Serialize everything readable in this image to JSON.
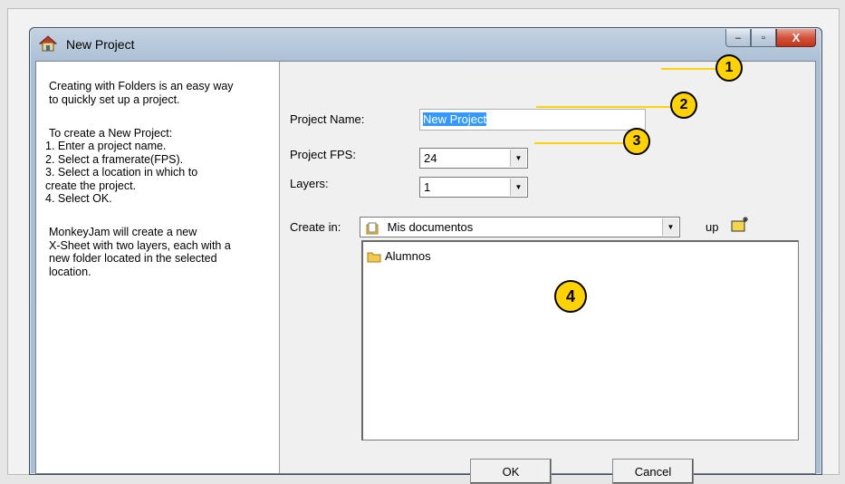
{
  "window": {
    "title": "New Project"
  },
  "caption": {
    "minimize": "–",
    "maximize": "▫",
    "close": "X"
  },
  "help": {
    "intro": "Creating with Folders is an easy way\nto quickly set up a project.",
    "steps_title": "To create a New Project:",
    "steps": "  1. Enter a project name.\n  2. Select a framerate(FPS).\n  3. Select a location in which to\n      create the project.\n  4. Select OK.",
    "outro": "MonkeyJam will create a new\nX-Sheet with two layers, each with a\nnew folder located in the selected\nlocation."
  },
  "form": {
    "project_name_label": "Project Name:",
    "project_name_value": "New Project",
    "fps_label": "Project FPS:",
    "fps_value": "24",
    "layers_label": "Layers:",
    "layers_value": "1",
    "create_in_label": "Create in:",
    "create_in_value": "Mis documentos",
    "up_label": "up"
  },
  "folder_list": [
    {
      "name": "Alumnos"
    }
  ],
  "buttons": {
    "ok": "OK",
    "cancel": "Cancel"
  },
  "callouts": [
    "1",
    "2",
    "3",
    "4"
  ],
  "colors": {
    "callout": "#ffd200",
    "selection": "#3399ff"
  }
}
